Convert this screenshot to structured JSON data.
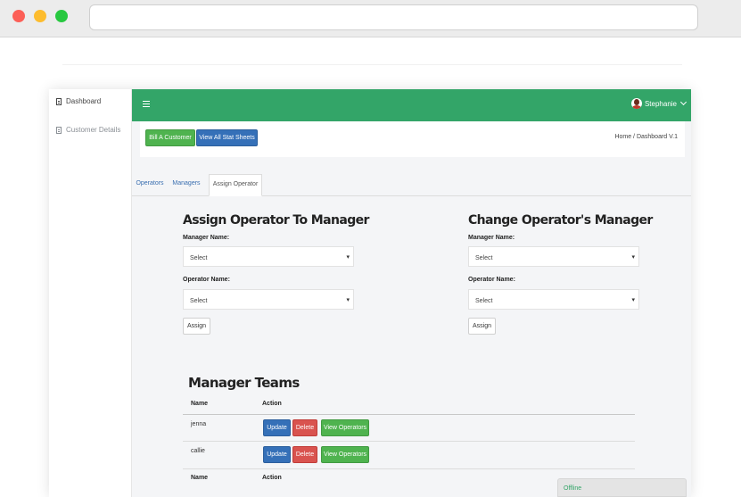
{
  "sidebar": {
    "items": [
      {
        "label": "Dashboard",
        "icon": "document-icon"
      },
      {
        "label": "Customer Details",
        "icon": "document-icon"
      }
    ]
  },
  "topbar": {
    "user_name": "Stephanie",
    "accent_color": "#33a568"
  },
  "actions": {
    "bill_customer": "Bill A Customer",
    "view_stat_sheets": "View All Stat Sheets",
    "breadcrumb": "Home / Dashboard V.1"
  },
  "tabs": [
    {
      "label": "Operators"
    },
    {
      "label": "Managers"
    },
    {
      "label": "Assign Operator",
      "active": true
    }
  ],
  "assign_form": {
    "title": "Assign Operator To Manager",
    "manager_label": "Manager Name:",
    "manager_value": "Select",
    "operator_label": "Operator Name:",
    "operator_value": "Select",
    "submit_label": "Assign"
  },
  "change_form": {
    "title": "Change Operator's Manager",
    "manager_label": "Manager Name:",
    "manager_value": "Select",
    "operator_label": "Operator Name:",
    "operator_value": "Select",
    "submit_label": "Assign"
  },
  "teams": {
    "title": "Manager Teams",
    "columns": [
      "Name",
      "Action"
    ],
    "rows": [
      {
        "name": "jenna"
      },
      {
        "name": "callie"
      }
    ],
    "update_label": "Update",
    "delete_label": "Delete",
    "view_label": "View Operators"
  },
  "chat": {
    "status": "Offline"
  }
}
